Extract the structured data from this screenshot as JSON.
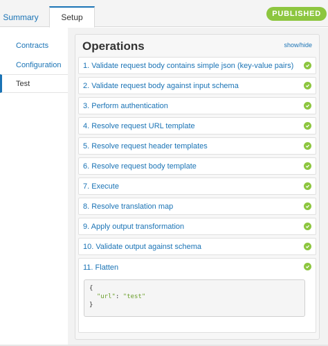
{
  "tabs": [
    {
      "label": "Summary",
      "active": false
    },
    {
      "label": "Setup",
      "active": true
    }
  ],
  "status": {
    "label": "PUBLISHED",
    "color": "#8dc63f"
  },
  "sidebar": {
    "items": [
      {
        "label": "Contracts",
        "active": false
      },
      {
        "label": "Configuration",
        "active": false
      },
      {
        "label": "Test",
        "active": true
      }
    ]
  },
  "operations": {
    "title": "Operations",
    "toggle_label": "show/hide",
    "steps": [
      {
        "label": "1. Validate request body contains simple json (key-value pairs)",
        "status": "success"
      },
      {
        "label": "2. Validate request body against input schema",
        "status": "success"
      },
      {
        "label": "3. Perform authentication",
        "status": "success"
      },
      {
        "label": "4. Resolve request URL template",
        "status": "success"
      },
      {
        "label": "5. Resolve request header templates",
        "status": "success"
      },
      {
        "label": "6. Resolve request body template",
        "status": "success"
      },
      {
        "label": "7. Execute",
        "status": "success"
      },
      {
        "label": "8. Resolve translation map",
        "status": "success"
      },
      {
        "label": "9. Apply output transformation",
        "status": "success"
      },
      {
        "label": "10. Validate output against schema",
        "status": "success"
      },
      {
        "label": "11. Flatten",
        "status": "success"
      }
    ],
    "output": {
      "open": "{",
      "key": "\"url\"",
      "sep": ": ",
      "value": "\"test\"",
      "close": "}"
    }
  },
  "colors": {
    "accent": "#1a73b5",
    "success": "#8dc63f"
  }
}
